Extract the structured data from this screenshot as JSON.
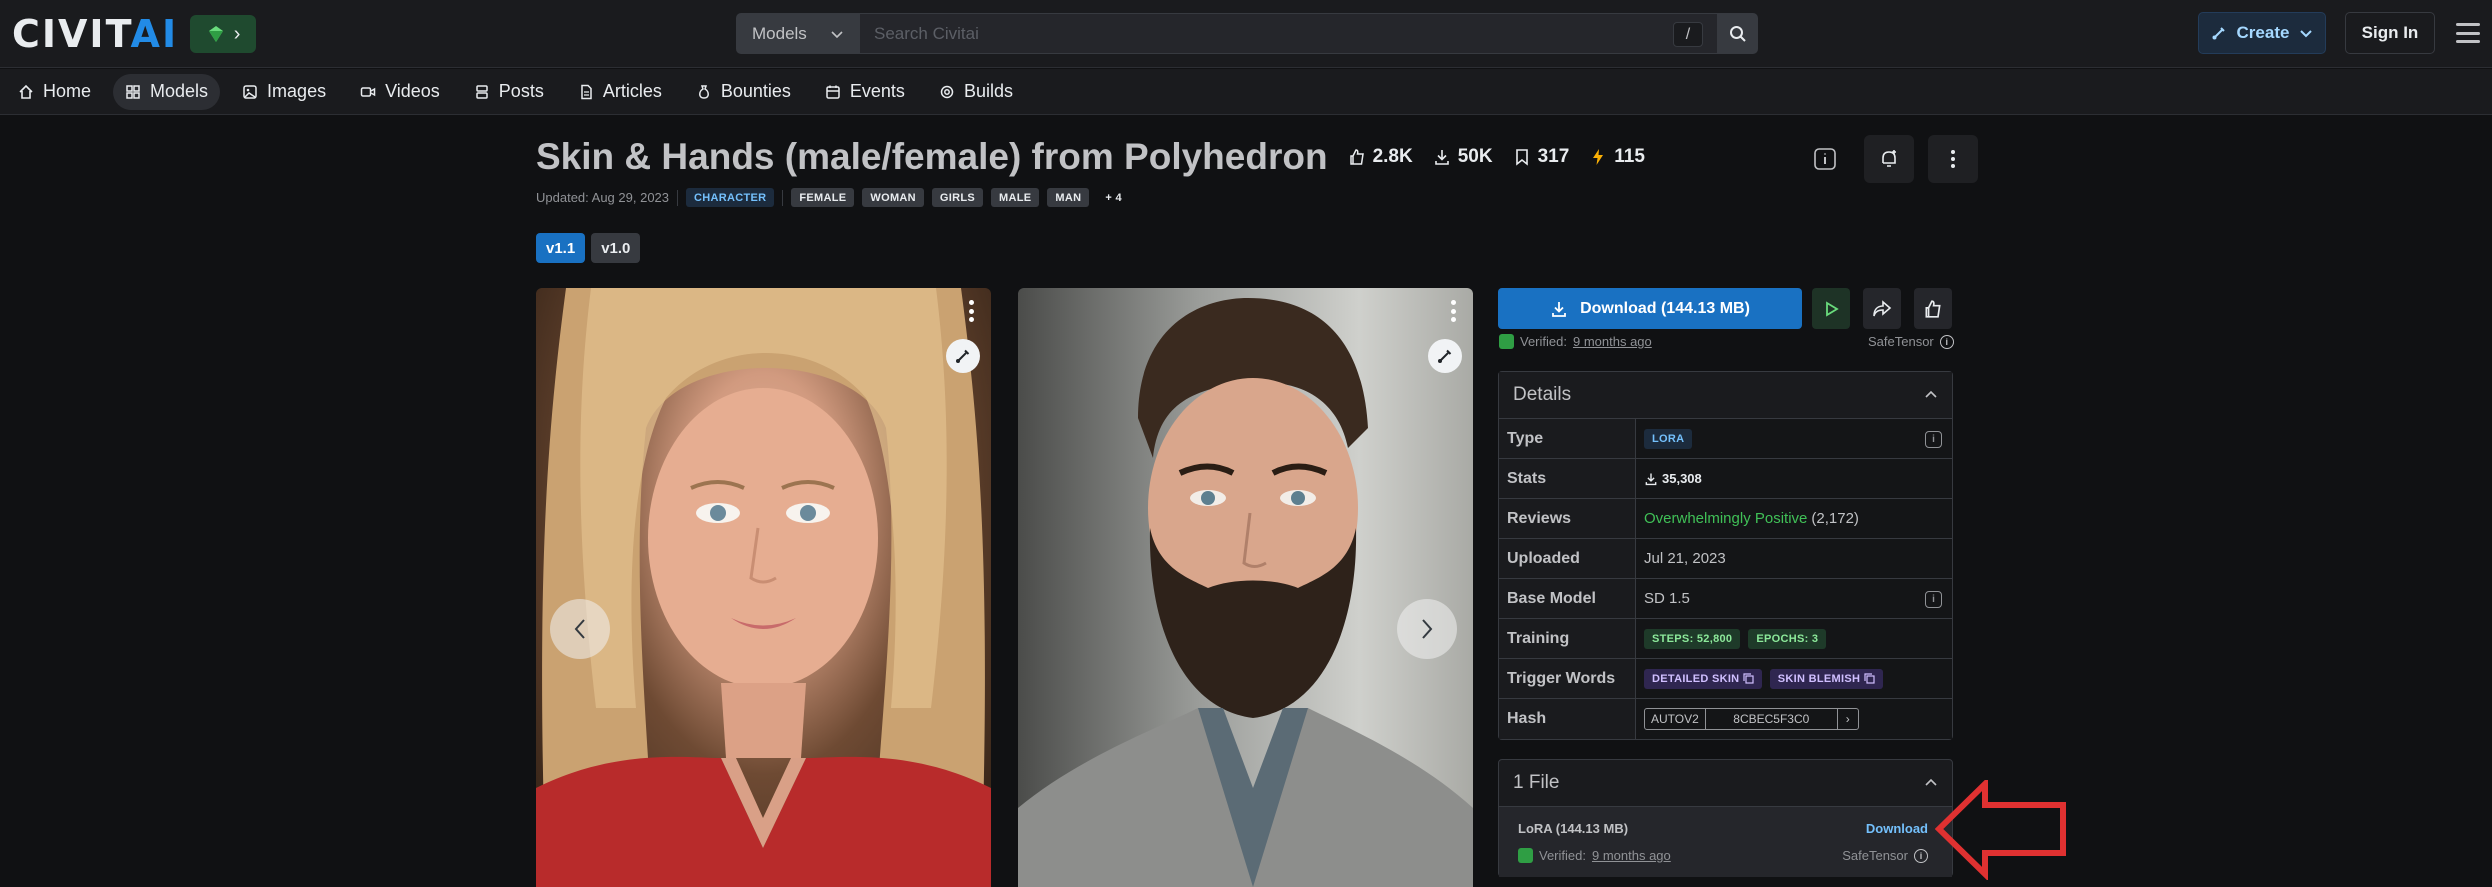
{
  "header": {
    "logo": "CIVITAI",
    "logo_main": "CIVIT",
    "logo_accent": "AI",
    "search": {
      "filter": "Models",
      "placeholder": "Search Civitai",
      "hotkey": "/"
    },
    "create_label": "Create",
    "signin_label": "Sign In"
  },
  "nav": {
    "items": [
      {
        "label": "Home",
        "icon": "home-icon"
      },
      {
        "label": "Models",
        "icon": "grid-icon",
        "active": true
      },
      {
        "label": "Images",
        "icon": "image-icon"
      },
      {
        "label": "Videos",
        "icon": "video-icon"
      },
      {
        "label": "Posts",
        "icon": "posts-icon"
      },
      {
        "label": "Articles",
        "icon": "article-icon"
      },
      {
        "label": "Bounties",
        "icon": "moneybag-icon"
      },
      {
        "label": "Events",
        "icon": "calendar-icon"
      },
      {
        "label": "Builds",
        "icon": "cpu-icon"
      }
    ]
  },
  "model": {
    "title": "Skin & Hands (male/female) from Polyhedron",
    "stats": {
      "likes": "2.8K",
      "downloads": "50K",
      "bookmarks": "317",
      "buzz": "115"
    },
    "updated": "Updated: Aug 29, 2023",
    "category": "CHARACTER",
    "tags": [
      "FEMALE",
      "WOMAN",
      "GIRLS",
      "MALE",
      "MAN"
    ],
    "more_tags": "+ 4",
    "versions": [
      "v1.1",
      "v1.0"
    ],
    "active_version": "v1.1"
  },
  "download": {
    "label": "Download (144.13 MB)",
    "verified_prefix": "Verified:",
    "verified_time": "9 months ago",
    "format": "SafeTensor"
  },
  "details": {
    "heading": "Details",
    "type_label": "Type",
    "type_value": "LORA",
    "stats_label": "Stats",
    "stats_value": "35,308",
    "reviews_label": "Reviews",
    "reviews_value": "Overwhelmingly Positive",
    "reviews_count": "(2,172)",
    "uploaded_label": "Uploaded",
    "uploaded_value": "Jul 21, 2023",
    "base_label": "Base Model",
    "base_value": "SD 1.5",
    "training_label": "Training",
    "training_steps": "STEPS: 52,800",
    "training_epochs": "EPOCHS: 3",
    "trigger_label": "Trigger Words",
    "trigger_1": "DETAILED SKIN",
    "trigger_2": "SKIN BLEMISH",
    "hash_label": "Hash",
    "hash_type": "AUTOV2",
    "hash_value": "8CBEC5F3C0"
  },
  "files": {
    "heading": "1 File",
    "name": "LoRA (144.13 MB)",
    "download_label": "Download",
    "verified_prefix": "Verified:",
    "verified_time": "9 months ago",
    "format": "SafeTensor"
  },
  "colors": {
    "accent": "#1971c2",
    "positive": "#40c057",
    "annotation": "#e03131"
  }
}
